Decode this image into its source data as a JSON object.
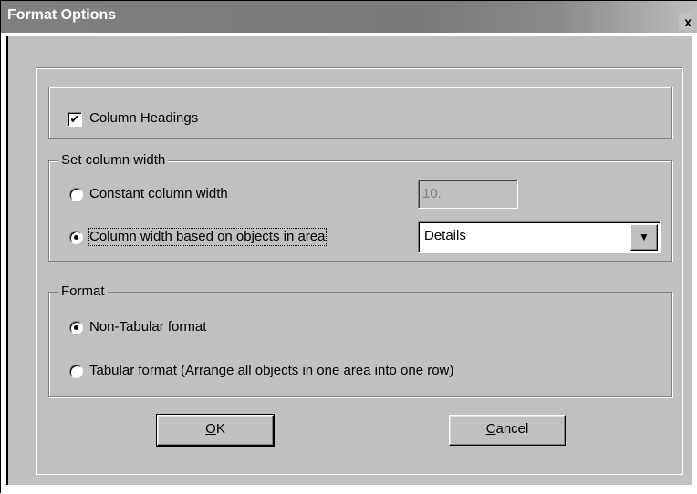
{
  "window": {
    "title": "Format Options",
    "close_glyph": "x"
  },
  "column_headings": {
    "label": "Column Headings",
    "checked": true,
    "check_glyph": "✔"
  },
  "column_width_group": {
    "legend": "Set column width",
    "options": [
      {
        "label": "Constant column width",
        "selected": false
      },
      {
        "label": "Column width based on objects in area",
        "selected": true
      }
    ],
    "constant_width_value": "10.",
    "area_select_value": "Details",
    "dropdown_glyph": "▼"
  },
  "format_group": {
    "legend": "Format",
    "options": [
      {
        "label": "Non-Tabular format",
        "selected": true
      },
      {
        "label": "Tabular format (Arrange all objects in one area into one row)",
        "selected": false
      }
    ]
  },
  "buttons": {
    "ok_mnemonic": "O",
    "ok_rest": "K",
    "cancel_mnemonic": "C",
    "cancel_rest": "ancel"
  },
  "colors": {
    "face": "#c0c0c0",
    "shadow": "#808080",
    "highlight": "#ffffff",
    "title_text": "#ffffff"
  }
}
